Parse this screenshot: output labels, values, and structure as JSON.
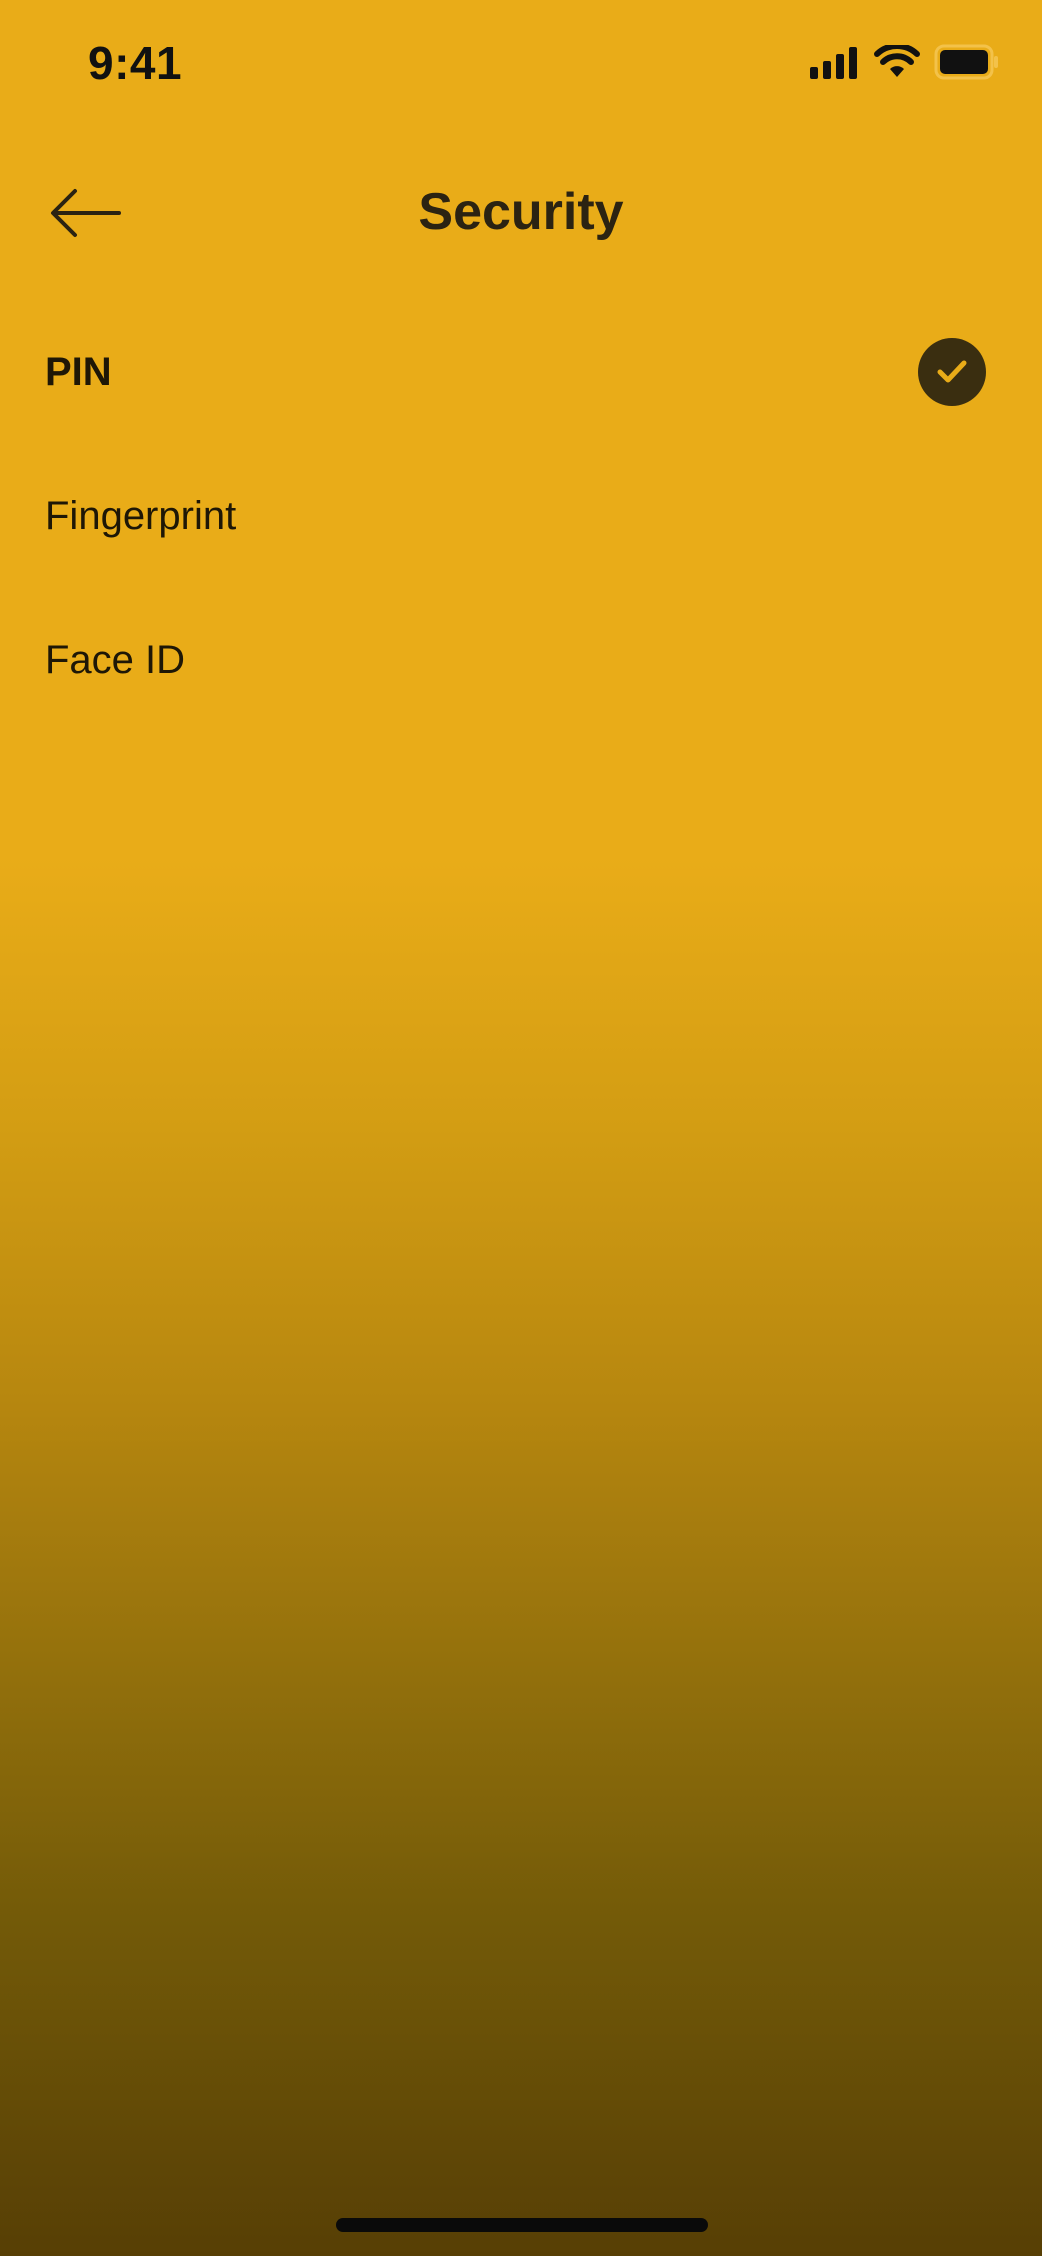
{
  "status_bar": {
    "time": "9:41",
    "icons": [
      "signal-icon",
      "wifi-icon",
      "battery-icon"
    ]
  },
  "header": {
    "title": "Security",
    "back_icon": "arrow-left-icon"
  },
  "options": [
    {
      "label": "PIN",
      "selected": true
    },
    {
      "label": "Fingerprint",
      "selected": false
    },
    {
      "label": "Face ID",
      "selected": false
    }
  ],
  "colors": {
    "background_top": "#e9ac18",
    "background_bottom": "#573f05",
    "check_badge": "#3a2e10",
    "check_mark": "#e9ac18",
    "text": "#1e1706"
  }
}
